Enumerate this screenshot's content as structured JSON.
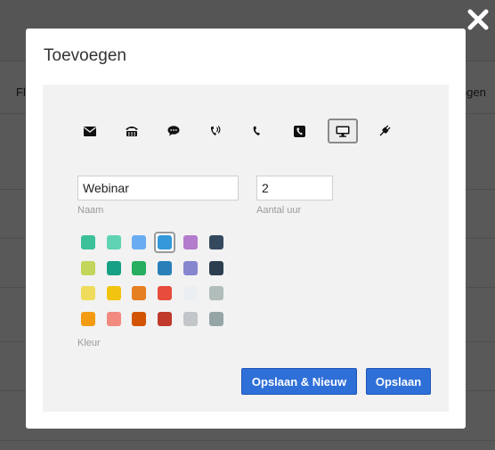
{
  "background": {
    "left_label": "Fl",
    "right_label": "ingen"
  },
  "dialog": {
    "title": "Toevoegen",
    "close_icon": "close-icon",
    "types": [
      {
        "icon": "envelope-icon",
        "selected": false
      },
      {
        "icon": "fax-icon",
        "selected": false
      },
      {
        "icon": "chat-bubble-icon",
        "selected": false
      },
      {
        "icon": "phone-ringing-icon",
        "selected": false
      },
      {
        "icon": "phone-icon",
        "selected": false
      },
      {
        "icon": "phone-square-icon",
        "selected": false
      },
      {
        "icon": "desktop-icon",
        "selected": true
      },
      {
        "icon": "plug-icon",
        "selected": false
      }
    ],
    "name_value": "Webinar",
    "name_label": "Naam",
    "hours_value": "2",
    "hours_label": "Aantal uur",
    "color_label": "Kleur",
    "colors": [
      [
        "#3cc09a",
        "#5fd3b3",
        "#6aacf2",
        "#3498db",
        "#b37ccc",
        "#34495e"
      ],
      [
        "#c3d55a",
        "#16a085",
        "#27ae60",
        "#2980b9",
        "#8686cf",
        "#2c3e50"
      ],
      [
        "#f0dc5c",
        "#f1c40f",
        "#e67e22",
        "#e74c3c",
        "#eceff1",
        "#b0bdba"
      ],
      [
        "#f39c12",
        "#f28a80",
        "#d35400",
        "#c0392b",
        "#c2c6c8",
        "#95a5a6"
      ]
    ],
    "selected_color": "#3498db",
    "save_new_label": "Opslaan & Nieuw",
    "save_label": "Opslaan"
  }
}
